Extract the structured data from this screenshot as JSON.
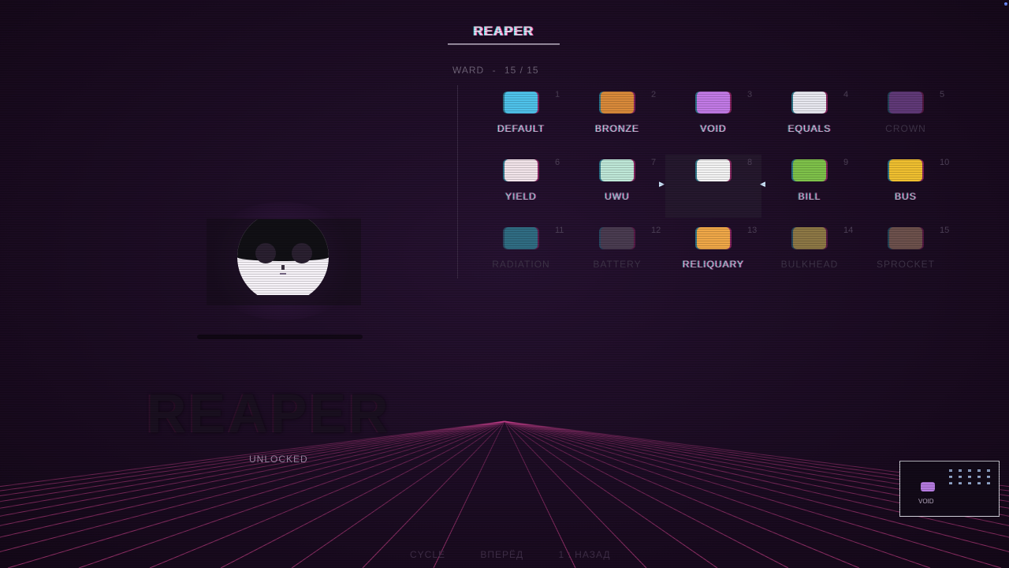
{
  "header": {
    "title": "REAPER"
  },
  "category": {
    "name": "WARD",
    "separator": "-",
    "count": "15 / 15"
  },
  "skins": [
    {
      "num": "1",
      "label": "DEFAULT",
      "icon": "default-skin-icon",
      "color": "#4fc2ea",
      "dim": false
    },
    {
      "num": "2",
      "label": "BRONZE",
      "icon": "bronze-skin-icon",
      "color": "#d98a3a",
      "dim": false
    },
    {
      "num": "3",
      "label": "VOID",
      "icon": "void-skin-icon",
      "color": "#c27ae6",
      "dim": false
    },
    {
      "num": "4",
      "label": "EQUALS",
      "icon": "equals-skin-icon",
      "color": "#e8e8f0",
      "dim": false
    },
    {
      "num": "5",
      "label": "CROWN",
      "icon": "crown-skin-icon",
      "color": "#9a5fc0",
      "dim": true
    },
    {
      "num": "6",
      "label": "YIELD",
      "icon": "yield-skin-icon",
      "color": "#f2e4ea",
      "dim": false
    },
    {
      "num": "7",
      "label": "UWU",
      "icon": "uwu-skin-icon",
      "color": "#bfe8d8",
      "dim": false
    },
    {
      "num": "8",
      "label": "",
      "icon": "reaper-skin-icon",
      "color": "#f4f4f4",
      "dim": false,
      "selected": true
    },
    {
      "num": "9",
      "label": "BILL",
      "icon": "bill-skin-icon",
      "color": "#7fc24a",
      "dim": false
    },
    {
      "num": "10",
      "label": "BUS",
      "icon": "bus-skin-icon",
      "color": "#f0c030",
      "dim": false
    },
    {
      "num": "11",
      "label": "RADIATION",
      "icon": "radiation-skin-icon",
      "color": "#3ab8c8",
      "dim": true
    },
    {
      "num": "12",
      "label": "BATTERY",
      "icon": "battery-skin-icon",
      "color": "#6a6070",
      "dim": true
    },
    {
      "num": "13",
      "label": "RELIQUARY",
      "icon": "reliquary-skin-icon",
      "color": "#f0a848",
      "dim": false
    },
    {
      "num": "14",
      "label": "BULKHEAD",
      "icon": "bulkhead-skin-icon",
      "color": "#e8d060",
      "dim": true
    },
    {
      "num": "15",
      "label": "SPROCKET",
      "icon": "sprocket-skin-icon",
      "color": "#b08a70",
      "dim": true
    }
  ],
  "preview": {
    "name": "REAPER",
    "status": "UNLOCKED"
  },
  "hints": {
    "cycle": "CYCLE",
    "forward": "ВПЕРЁД",
    "back": "1 : НАЗАД"
  },
  "minimap": {
    "label": "VOID"
  }
}
